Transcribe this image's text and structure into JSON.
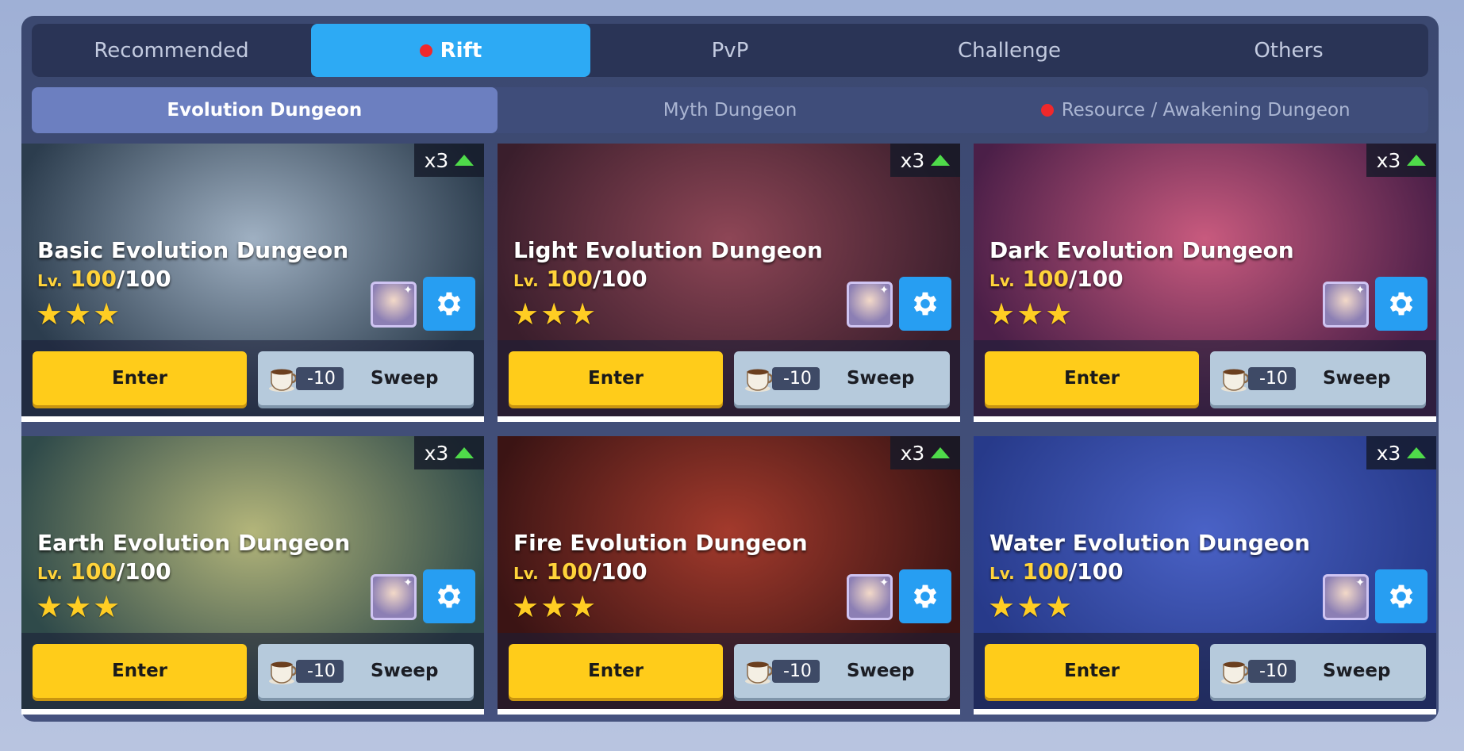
{
  "tabs": [
    {
      "label": "Recommended",
      "active": false,
      "alert": false
    },
    {
      "label": "Rift",
      "active": true,
      "alert": true
    },
    {
      "label": "PvP",
      "active": false,
      "alert": false
    },
    {
      "label": "Challenge",
      "active": false,
      "alert": false
    },
    {
      "label": "Others",
      "active": false,
      "alert": false
    }
  ],
  "subtabs": [
    {
      "label": "Evolution Dungeon",
      "active": true,
      "alert": false
    },
    {
      "label": "Myth Dungeon",
      "active": false,
      "alert": false
    },
    {
      "label": "Resource / Awakening Dungeon",
      "active": false,
      "alert": true
    }
  ],
  "dungeons": [
    {
      "name": "Basic Evolution Dungeon",
      "multiplier": "x3",
      "lv_prefix": "Lv.",
      "level": "100",
      "max_level": "/100",
      "stars": 3,
      "enter_label": "Enter",
      "sweep_cost": "-10",
      "sweep_label": "Sweep",
      "theme": [
        "#2c3d4e",
        "#9fb0c2"
      ]
    },
    {
      "name": "Light Evolution Dungeon",
      "multiplier": "x3",
      "lv_prefix": "Lv.",
      "level": "100",
      "max_level": "/100",
      "stars": 3,
      "enter_label": "Enter",
      "sweep_cost": "-10",
      "sweep_label": "Sweep",
      "theme": [
        "#3a1e2c",
        "#8e4656"
      ]
    },
    {
      "name": "Dark Evolution Dungeon",
      "multiplier": "x3",
      "lv_prefix": "Lv.",
      "level": "100",
      "max_level": "/100",
      "stars": 3,
      "enter_label": "Enter",
      "sweep_cost": "-10",
      "sweep_label": "Sweep",
      "theme": [
        "#4b1f48",
        "#c85a7e"
      ]
    },
    {
      "name": "Earth Evolution Dungeon",
      "multiplier": "x3",
      "lv_prefix": "Lv.",
      "level": "100",
      "max_level": "/100",
      "stars": 3,
      "enter_label": "Enter",
      "sweep_cost": "-10",
      "sweep_label": "Sweep",
      "theme": [
        "#2f4a4a",
        "#b3b57a"
      ]
    },
    {
      "name": "Fire Evolution Dungeon",
      "multiplier": "x3",
      "lv_prefix": "Lv.",
      "level": "100",
      "max_level": "/100",
      "stars": 3,
      "enter_label": "Enter",
      "sweep_cost": "-10",
      "sweep_label": "Sweep",
      "theme": [
        "#3b1414",
        "#a33a2c"
      ]
    },
    {
      "name": "Water Evolution Dungeon",
      "multiplier": "x3",
      "lv_prefix": "Lv.",
      "level": "100",
      "max_level": "/100",
      "stars": 3,
      "enter_label": "Enter",
      "sweep_cost": "-10",
      "sweep_label": "Sweep",
      "theme": [
        "#273a8a",
        "#4a62c6"
      ]
    }
  ]
}
